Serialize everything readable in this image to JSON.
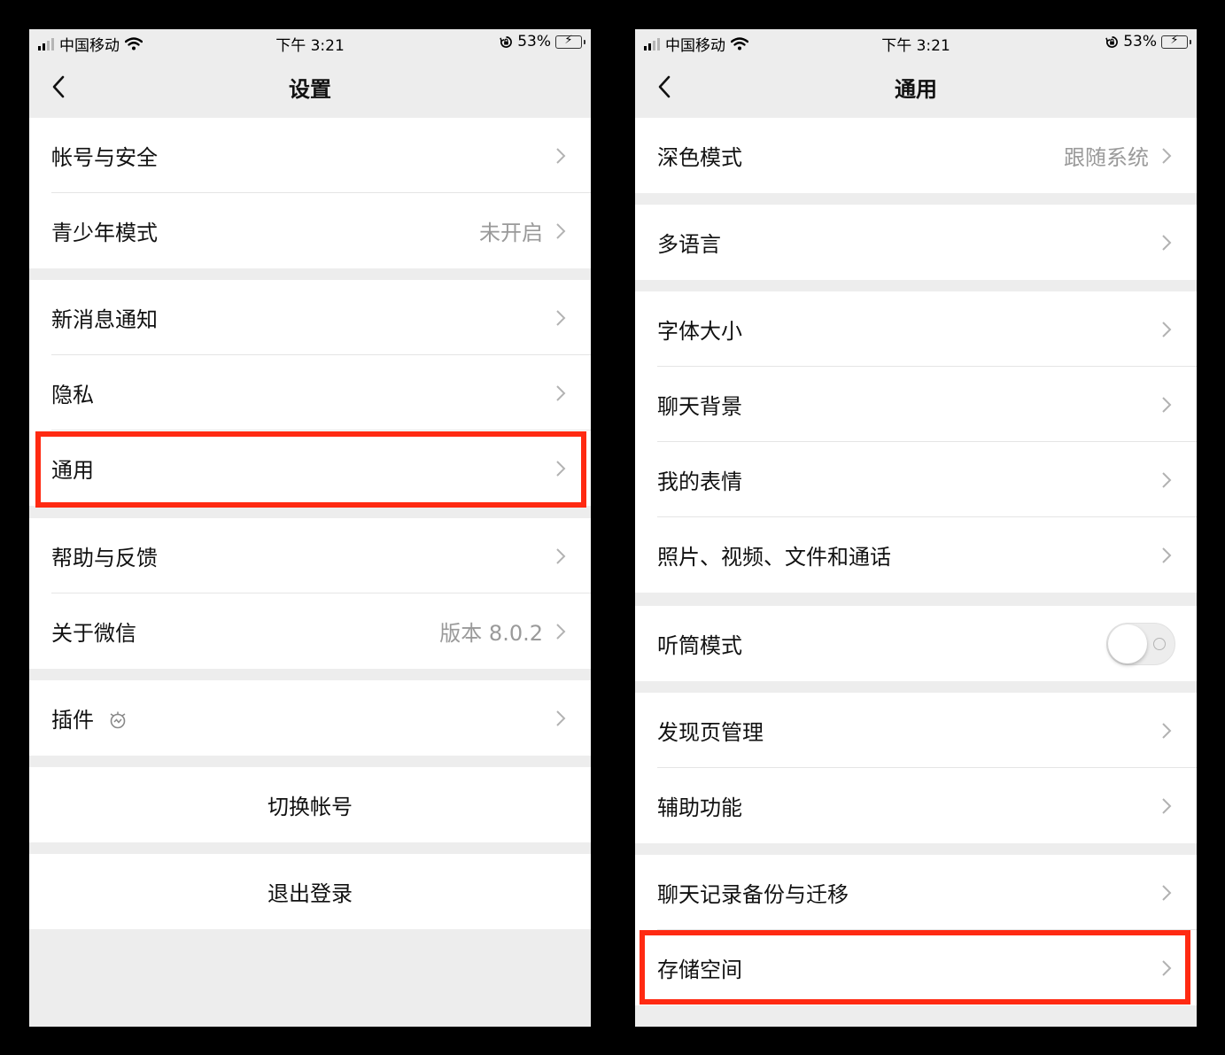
{
  "status_bar": {
    "carrier": "中国移动",
    "time": "下午 3:21",
    "battery": "53%",
    "battery_level": 0.53,
    "icons": [
      "signal-icon",
      "wifi-icon",
      "orientation-lock-icon",
      "battery-charging-icon"
    ]
  },
  "settings_screen": {
    "title": "设置",
    "rows": [
      {
        "label": "帐号与安全"
      },
      {
        "label": "青少年模式",
        "value": "未开启"
      },
      {
        "label": "新消息通知"
      },
      {
        "label": "隐私"
      },
      {
        "label": "通用",
        "highlighted": true
      },
      {
        "label": "帮助与反馈"
      },
      {
        "label": "关于微信",
        "value": "版本 8.0.2"
      },
      {
        "label": "插件",
        "icon": "plugin-icon"
      }
    ],
    "switch_account": "切换帐号",
    "logout": "退出登录"
  },
  "general_screen": {
    "title": "通用",
    "rows": [
      {
        "label": "深色模式",
        "value": "跟随系统"
      },
      {
        "label": "多语言"
      },
      {
        "label": "字体大小"
      },
      {
        "label": "聊天背景"
      },
      {
        "label": "我的表情"
      },
      {
        "label": "照片、视频、文件和通话"
      },
      {
        "label": "听筒模式",
        "toggle": false
      },
      {
        "label": "发现页管理"
      },
      {
        "label": "辅助功能"
      },
      {
        "label": "聊天记录备份与迁移"
      },
      {
        "label": "存储空间",
        "highlighted": true
      }
    ]
  },
  "colors": {
    "background": "#ededed",
    "highlight": "#ff2a12",
    "secondary_text": "#9a9a9a"
  }
}
